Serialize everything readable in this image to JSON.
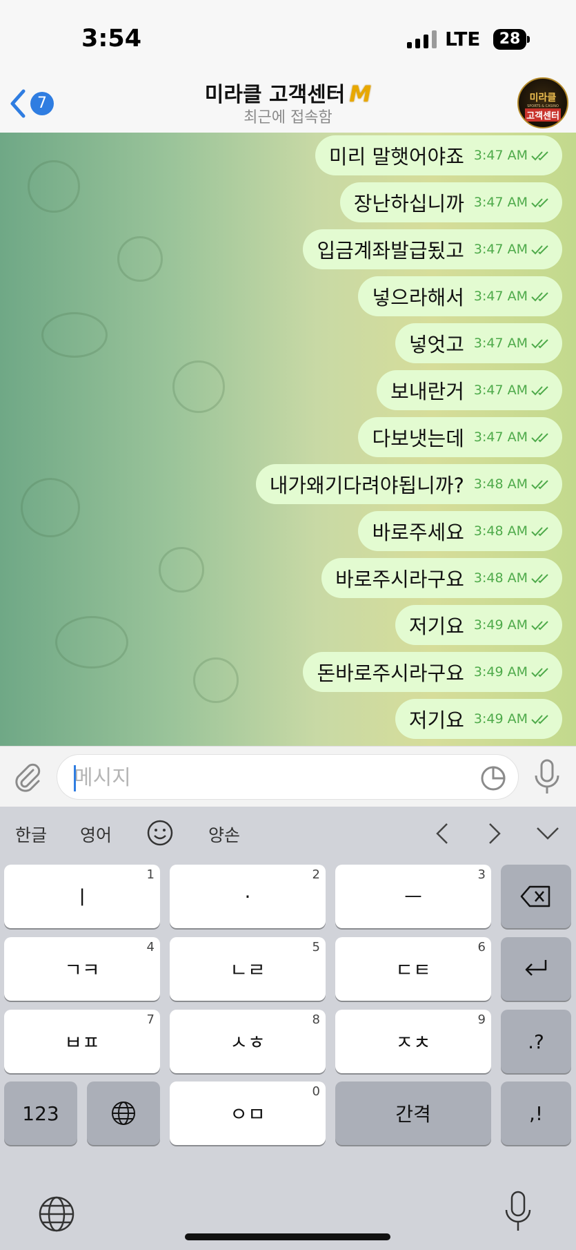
{
  "status_bar": {
    "time": "3:54",
    "network": "LTE",
    "battery": "28"
  },
  "header": {
    "back_count": "7",
    "title": "미라클 고객센터",
    "title_badge": "M",
    "subtitle": "최근에 접속함",
    "avatar": {
      "line1": "미라클",
      "line2": "SPORTS & CASINO",
      "line3": "고객센터"
    }
  },
  "messages": [
    {
      "text": "미리 말햇어야죠",
      "time": "3:47 AM"
    },
    {
      "text": "장난하십니까",
      "time": "3:47 AM"
    },
    {
      "text": "입금계좌발급됬고",
      "time": "3:47 AM"
    },
    {
      "text": "넣으라해서",
      "time": "3:47 AM"
    },
    {
      "text": "넣엇고",
      "time": "3:47 AM"
    },
    {
      "text": "보내란거",
      "time": "3:47 AM"
    },
    {
      "text": "다보냇는데",
      "time": "3:47 AM"
    },
    {
      "text": "내가왜기다려야됩니까?",
      "time": "3:48 AM"
    },
    {
      "text": "바로주세요",
      "time": "3:48 AM"
    },
    {
      "text": "바로주시라구요",
      "time": "3:48 AM"
    },
    {
      "text": "저기요",
      "time": "3:49 AM"
    },
    {
      "text": "돈바로주시라구요",
      "time": "3:49 AM"
    },
    {
      "text": "저기요",
      "time": "3:49 AM"
    }
  ],
  "input": {
    "placeholder": "메시지"
  },
  "keyboard": {
    "suggestions": [
      "한글",
      "영어",
      "양손"
    ],
    "rows": [
      [
        {
          "label": "ㅣ",
          "num": "1"
        },
        {
          "label": "·",
          "num": "2"
        },
        {
          "label": "ㅡ",
          "num": "3"
        }
      ],
      [
        {
          "label": "ㄱㅋ",
          "num": "4"
        },
        {
          "label": "ㄴㄹ",
          "num": "5"
        },
        {
          "label": "ㄷㅌ",
          "num": "6"
        }
      ],
      [
        {
          "label": "ㅂㅍ",
          "num": "7"
        },
        {
          "label": "ㅅㅎ",
          "num": "8"
        },
        {
          "label": "ㅈㅊ",
          "num": "9"
        }
      ]
    ],
    "punct1": ".?",
    "punct2": ",!",
    "numbers_key": "123",
    "bottom_center": {
      "label": "ㅇㅁ",
      "num": "0"
    },
    "space": "간격"
  },
  "colors": {
    "accent": "#2f7de1",
    "bubble": "#e3fbd1",
    "time": "#4eaa4a"
  }
}
